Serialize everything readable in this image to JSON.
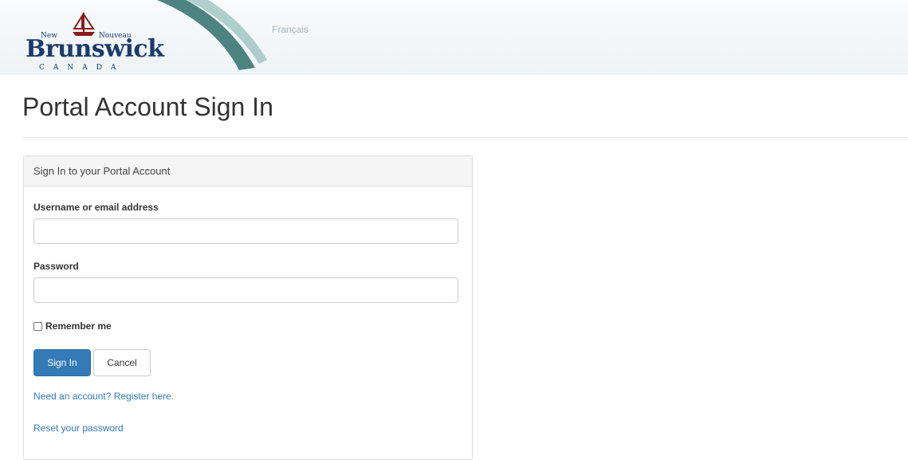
{
  "header": {
    "logo": {
      "word": "Brunswick",
      "new": "New",
      "nouveau": "Nouveau",
      "country": "CANADA",
      "brand_color": "#1c3a6b"
    },
    "language_link": "Français"
  },
  "page_title": "Portal Account Sign In",
  "panel": {
    "heading": "Sign In to your Portal Account",
    "username": {
      "label": "Username or email address",
      "value": "",
      "placeholder": ""
    },
    "password": {
      "label": "Password",
      "value": "",
      "placeholder": ""
    },
    "remember_me": {
      "label": "Remember me",
      "checked": false
    },
    "sign_in_label": "Sign In",
    "cancel_label": "Cancel",
    "register_link": "Need an account? Register here.",
    "reset_link": "Reset your password"
  },
  "colors": {
    "primary": "#337ab7",
    "link": "#337ab7",
    "header_bg": "#eef3f6",
    "swoosh": "#2f6f6b"
  }
}
